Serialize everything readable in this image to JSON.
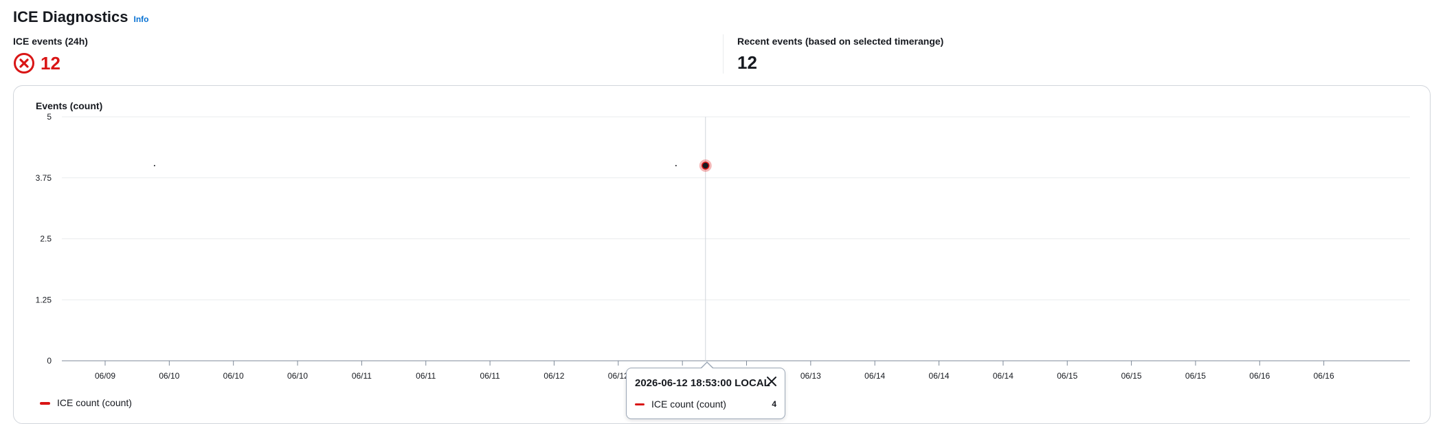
{
  "header": {
    "title": "ICE Diagnostics",
    "info_label": "Info"
  },
  "kpis": {
    "ice_events_24h": {
      "label": "ICE events (24h)",
      "value": "12",
      "icon": "error-circle-icon"
    },
    "recent_events": {
      "label": "Recent events (based on selected timerange)",
      "value": "12"
    }
  },
  "colors": {
    "error": "#d91515",
    "series": "#d91515",
    "grid": "#e9ebed",
    "axis_text": "#16191f",
    "link": "#0972d3"
  },
  "chart_data": {
    "type": "line",
    "title": "Events (count)",
    "xlabel": "",
    "ylabel": "",
    "ylim": [
      0,
      5
    ],
    "yticks": [
      "0",
      "1.25",
      "2.5",
      "3.75",
      "5"
    ],
    "ytick_values": [
      0,
      1.25,
      2.5,
      3.75,
      5
    ],
    "xticks": [
      "06/09",
      "06/10",
      "06/10",
      "06/10",
      "06/11",
      "06/11",
      "06/11",
      "06/12",
      "06/12",
      "06/12",
      "06/13",
      "06/13",
      "06/14",
      "06/14",
      "06/14",
      "06/15",
      "06/15",
      "06/15",
      "06/16",
      "06/16"
    ],
    "grid": true,
    "legend_position": "bottom-left",
    "series": [
      {
        "name": "ICE count (count)",
        "points": [
          {
            "tick_index": 0.77,
            "value": 4
          },
          {
            "tick_index": 8.9,
            "value": 4
          },
          {
            "tick_index": 9.36,
            "value": 4
          }
        ]
      }
    ],
    "highlight": {
      "series_index": 0,
      "point_index": 2
    }
  },
  "tooltip": {
    "title": "2026-06-12 18:53:00 LOCAL",
    "series_name": "ICE count (count)",
    "value": "4"
  }
}
